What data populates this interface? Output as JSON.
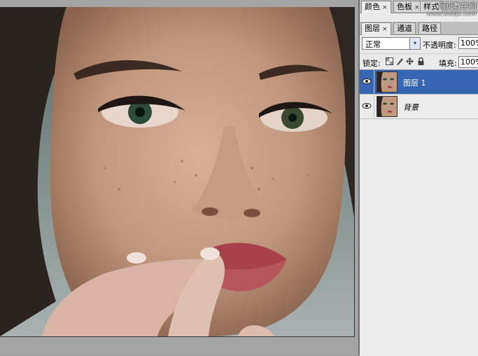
{
  "tabs_top": [
    {
      "label": "颜色",
      "close": "×",
      "active": true
    },
    {
      "label": "色板",
      "close": "×",
      "active": false
    },
    {
      "label": "样式",
      "close": "",
      "active": false
    }
  ],
  "watermark": {
    "line1": "网页教学网",
    "line2": "www.webjx.com"
  },
  "tabs_layers": [
    {
      "label": "图层",
      "close": "×",
      "active": true
    },
    {
      "label": "通道",
      "active": false
    },
    {
      "label": "路径",
      "active": false
    }
  ],
  "blend_mode": {
    "value": "正常",
    "arrow": "▾"
  },
  "opacity": {
    "label": "不透明度:",
    "value": "100%"
  },
  "lock": {
    "label": "锁定:",
    "icons": [
      "lock-transparency-icon",
      "lock-paint-icon",
      "lock-move-icon",
      "lock-all-icon"
    ]
  },
  "fill": {
    "label": "填充:",
    "value": "100%"
  },
  "layers": [
    {
      "name": "图层 1",
      "selected": true,
      "visible": true
    },
    {
      "name": "背景",
      "selected": false,
      "visible": true
    }
  ],
  "icons": {
    "eye": "👁",
    "eye_fallback": "◉"
  }
}
